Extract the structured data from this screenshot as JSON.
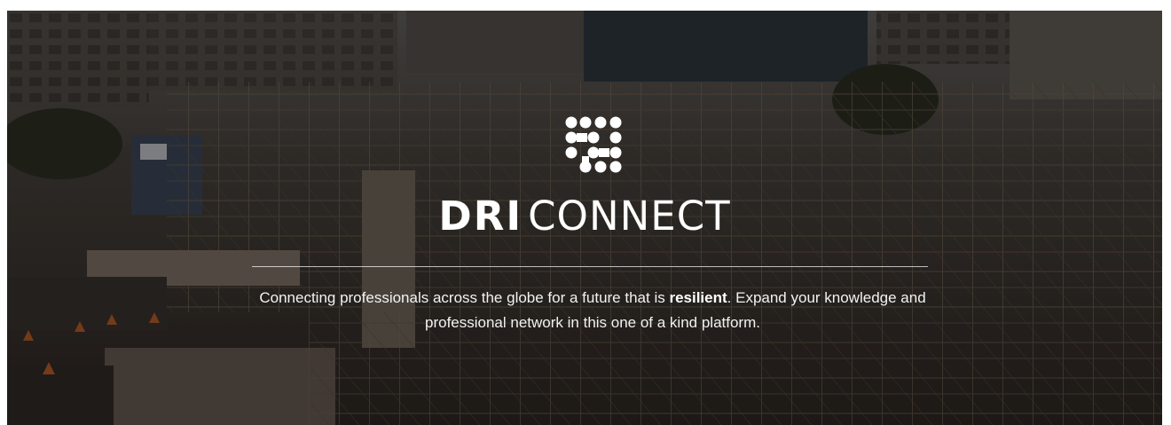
{
  "brand": {
    "name_strong": "DRI",
    "name_light": "CONNECT",
    "logo_icon": "dot-grid-logo-icon"
  },
  "tagline": {
    "before": "Connecting professionals across the globe for a future that is ",
    "emphasis": "resilient",
    "after": ". Expand your knowledge and professional network in this one of a kind platform."
  },
  "colors": {
    "text": "#ffffff",
    "overlay": "#0a0806"
  }
}
